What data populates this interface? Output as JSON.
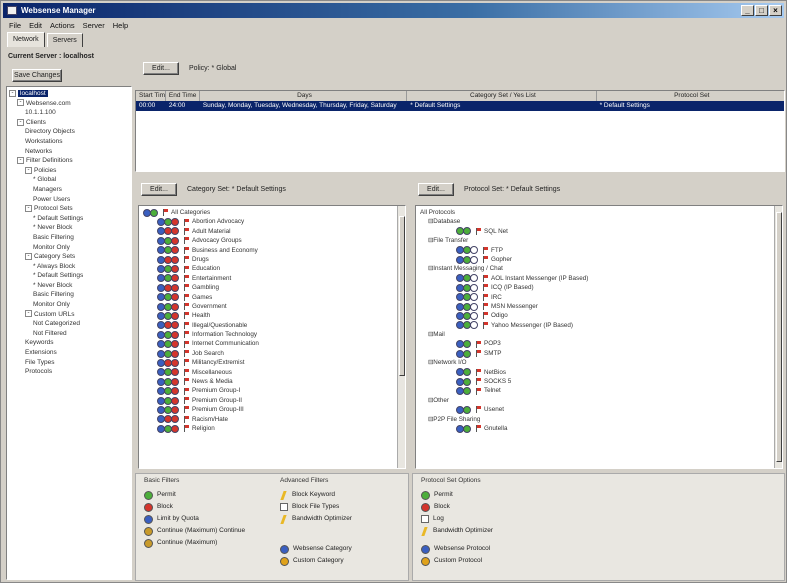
{
  "window": {
    "title": "Websense Manager",
    "buttons": [
      "_",
      "□",
      "×"
    ]
  },
  "menu": [
    "File",
    "Edit",
    "Actions",
    "Server",
    "Help"
  ],
  "tabs": [
    "Network",
    "Servers"
  ],
  "left": {
    "current_server": "Current Server : localhost",
    "button": "Save Changes",
    "tree": [
      {
        "label": "localhost",
        "depth": 0,
        "sel": true,
        "ex": "-"
      },
      {
        "label": "Websense.com",
        "depth": 1,
        "ex": "-"
      },
      {
        "label": "10.1.1.100",
        "depth": 2
      },
      {
        "label": "Clients",
        "depth": 1,
        "ex": "-"
      },
      {
        "label": "Directory Objects",
        "depth": 2
      },
      {
        "label": "Workstations",
        "depth": 2
      },
      {
        "label": "Networks",
        "depth": 2
      },
      {
        "label": "Filter Definitions",
        "depth": 1,
        "ex": "-"
      },
      {
        "label": "Policies",
        "depth": 2,
        "ex": "-"
      },
      {
        "label": "* Global",
        "depth": 3
      },
      {
        "label": "Managers",
        "depth": 3
      },
      {
        "label": "Power Users",
        "depth": 3
      },
      {
        "label": "Protocol Sets",
        "depth": 2,
        "ex": "-"
      },
      {
        "label": "* Default Settings",
        "depth": 3
      },
      {
        "label": "* Never Block",
        "depth": 3
      },
      {
        "label": "Basic Filtering",
        "depth": 3
      },
      {
        "label": "Monitor Only",
        "depth": 3
      },
      {
        "label": "Category Sets",
        "depth": 2,
        "ex": "-"
      },
      {
        "label": "* Always Block",
        "depth": 3
      },
      {
        "label": "* Default Settings",
        "depth": 3
      },
      {
        "label": "* Never Block",
        "depth": 3
      },
      {
        "label": "Basic Filtering",
        "depth": 3
      },
      {
        "label": "Monitor Only",
        "depth": 3
      },
      {
        "label": "Custom URLs",
        "depth": 2,
        "ex": "-"
      },
      {
        "label": "Not Categorized",
        "depth": 3
      },
      {
        "label": "Not Filtered",
        "depth": 3
      },
      {
        "label": "Keywords",
        "depth": 2
      },
      {
        "label": "Extensions",
        "depth": 2
      },
      {
        "label": "File Types",
        "depth": 2
      },
      {
        "label": "Protocols",
        "depth": 2
      }
    ]
  },
  "top": {
    "edit_button": "Edit...",
    "policy_label": "Policy: * Global",
    "columns": [
      "Start Time",
      "End Time",
      "Days",
      "Category Set / Yes List",
      "Protocol Set"
    ],
    "rows": [
      [
        "00:00",
        "24:00",
        "Sunday, Monday, Tuesday, Wednesday, Thursday, Friday, Saturday",
        "* Default Settings",
        "* Default Settings"
      ]
    ]
  },
  "category_panel": {
    "edit_button": "Edit...",
    "header": "Category Set: * Default Settings",
    "root": "All Categories",
    "items": [
      {
        "label": "Abortion Advocacy",
        "c": [
          "b",
          "g",
          "r"
        ]
      },
      {
        "label": "Adult Material",
        "c": [
          "b",
          "r",
          "r"
        ]
      },
      {
        "label": "Advocacy Groups",
        "c": [
          "b",
          "g",
          "r"
        ]
      },
      {
        "label": "Business and Economy",
        "c": [
          "b",
          "g",
          "r"
        ]
      },
      {
        "label": "Drugs",
        "c": [
          "b",
          "r",
          "r"
        ]
      },
      {
        "label": "Education",
        "c": [
          "b",
          "g",
          "r"
        ]
      },
      {
        "label": "Entertainment",
        "c": [
          "b",
          "g",
          "r"
        ]
      },
      {
        "label": "Gambling",
        "c": [
          "b",
          "r",
          "r"
        ]
      },
      {
        "label": "Games",
        "c": [
          "b",
          "g",
          "r"
        ]
      },
      {
        "label": "Government",
        "c": [
          "b",
          "g",
          "r"
        ]
      },
      {
        "label": "Health",
        "c": [
          "b",
          "g",
          "r"
        ]
      },
      {
        "label": "Illegal/Questionable",
        "c": [
          "b",
          "r",
          "r"
        ]
      },
      {
        "label": "Information Technology",
        "c": [
          "b",
          "g",
          "r"
        ]
      },
      {
        "label": "Internet Communication",
        "c": [
          "b",
          "g",
          "r"
        ]
      },
      {
        "label": "Job Search",
        "c": [
          "b",
          "g",
          "r"
        ]
      },
      {
        "label": "Militancy/Extremist",
        "c": [
          "b",
          "r",
          "r"
        ]
      },
      {
        "label": "Miscellaneous",
        "c": [
          "b",
          "g",
          "r"
        ]
      },
      {
        "label": "News & Media",
        "c": [
          "b",
          "g",
          "r"
        ]
      },
      {
        "label": "Premium Group-I",
        "c": [
          "b",
          "g",
          "r"
        ]
      },
      {
        "label": "Premium Group-II",
        "c": [
          "b",
          "g",
          "r"
        ]
      },
      {
        "label": "Premium Group-III",
        "c": [
          "b",
          "g",
          "r"
        ]
      },
      {
        "label": "Racism/Hate",
        "c": [
          "b",
          "r",
          "r"
        ]
      },
      {
        "label": "Religion",
        "c": [
          "b",
          "g",
          "r"
        ]
      }
    ]
  },
  "protocol_panel": {
    "edit_button": "Edit...",
    "header": "Protocol Set: * Default Settings",
    "root": "All Protocols",
    "items": [
      {
        "label": "Database",
        "group": true
      },
      {
        "label": "SQL Net",
        "c": [
          "g",
          "g"
        ]
      },
      {
        "label": "File Transfer",
        "group": true
      },
      {
        "label": "FTP",
        "c": [
          "b",
          "g",
          "w"
        ]
      },
      {
        "label": "Gopher",
        "c": [
          "b",
          "g",
          "w"
        ]
      },
      {
        "label": "Instant Messaging / Chat",
        "group": true
      },
      {
        "label": "AOL Instant Messenger (IP Based)",
        "c": [
          "b",
          "g",
          "w"
        ]
      },
      {
        "label": "ICQ (IP Based)",
        "c": [
          "b",
          "g",
          "w"
        ]
      },
      {
        "label": "IRC",
        "c": [
          "b",
          "g",
          "w"
        ]
      },
      {
        "label": "MSN Messenger",
        "c": [
          "b",
          "g",
          "w"
        ]
      },
      {
        "label": "Odigo",
        "c": [
          "b",
          "g",
          "w"
        ]
      },
      {
        "label": "Yahoo Messenger (IP Based)",
        "c": [
          "b",
          "g",
          "w"
        ]
      },
      {
        "label": "Mail",
        "group": true
      },
      {
        "label": "POP3",
        "c": [
          "b",
          "g"
        ]
      },
      {
        "label": "SMTP",
        "c": [
          "b",
          "g"
        ]
      },
      {
        "label": "Network I/O",
        "group": true
      },
      {
        "label": "NetBios",
        "c": [
          "b",
          "g"
        ]
      },
      {
        "label": "SOCKS 5",
        "c": [
          "b",
          "g"
        ]
      },
      {
        "label": "Telnet",
        "c": [
          "b",
          "g"
        ]
      },
      {
        "label": "Other",
        "group": true
      },
      {
        "label": "Usenet",
        "c": [
          "b",
          "g"
        ]
      },
      {
        "label": "P2P File Sharing",
        "group": true
      },
      {
        "label": "Gnutella",
        "c": [
          "b",
          "g"
        ]
      }
    ]
  },
  "legend_left": {
    "basic_title": "Basic Filters",
    "basic": [
      {
        "label": "Permit",
        "icon": "permit-icon",
        "color": "#4cae3a"
      },
      {
        "label": "Block",
        "icon": "block-icon",
        "color": "#d4352c"
      },
      {
        "label": "Limit by Quota",
        "icon": "quota-icon",
        "color": "#3a5fc0"
      },
      {
        "label": "Continue (Maximum) Continue",
        "icon": "continue-icon",
        "color": "#c89a2a"
      },
      {
        "label": "Continue (Maximum)",
        "icon": "continue-max-icon",
        "color": "#c89a2a"
      }
    ],
    "advanced_title": "Advanced Filters",
    "advanced": [
      {
        "label": "Block Keyword",
        "icon": "keyword-icon"
      },
      {
        "label": "Block File Types",
        "icon": "filetype-icon"
      },
      {
        "label": "Bandwidth Optimizer",
        "icon": "bandwidth-icon"
      }
    ],
    "extra": [
      {
        "label": "Websense Category",
        "icon": "websense-category-icon",
        "color": "#3a5fc0"
      },
      {
        "label": "Custom Category",
        "icon": "custom-category-icon",
        "color": "#e0a21a"
      }
    ]
  },
  "legend_right": {
    "title": "Protocol Set Options",
    "items": [
      {
        "label": "Permit",
        "icon": "permit-icon",
        "color": "#4cae3a"
      },
      {
        "label": "Block",
        "icon": "block-icon",
        "color": "#d4352c"
      },
      {
        "label": "Log",
        "icon": "log-icon"
      },
      {
        "label": "Bandwidth Optimizer",
        "icon": "bandwidth-icon"
      }
    ],
    "extra": [
      {
        "label": "Websense Protocol",
        "icon": "websense-protocol-icon",
        "color": "#3a5fc0"
      },
      {
        "label": "Custom Protocol",
        "icon": "custom-protocol-icon",
        "color": "#e0a21a"
      }
    ]
  }
}
